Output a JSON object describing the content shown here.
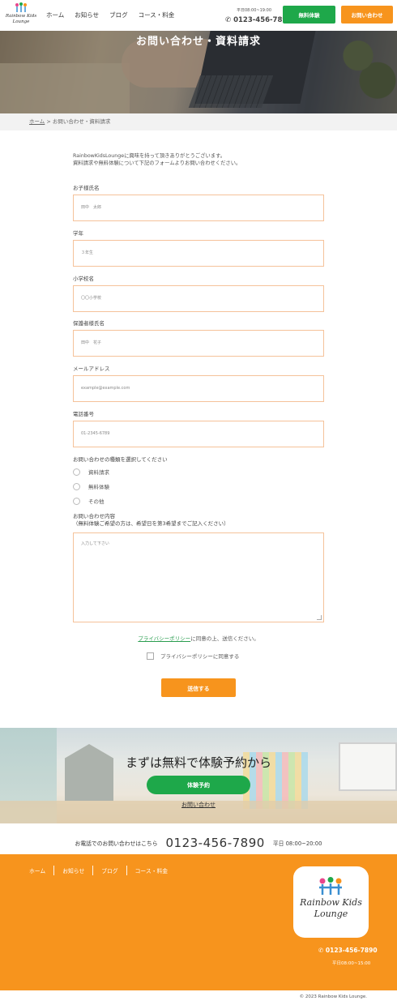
{
  "header": {
    "logo_text_line1": "Rainbow Kids",
    "logo_text_line2": "Lounge",
    "nav": [
      "ホーム",
      "お知らせ",
      "ブログ",
      "コース・料金"
    ],
    "hours": "平日08:00~19:00",
    "phone": "0123-456-7890",
    "trial_button": "無料体験",
    "contact_button": "お問い合わせ"
  },
  "hero": {
    "title": "お問い合わせ・資料請求"
  },
  "breadcrumb": {
    "home": "ホーム",
    "separator": ">",
    "current": "お問い合わせ・資料請求"
  },
  "form": {
    "intro_line1": "RainbowKidsLoungeに興味を持って頂きありがとうございます。",
    "intro_line2": "資料請求や無料体験について下記のフォームよりお問い合わせください。",
    "child_name_label": "お子様氏名",
    "child_name_placeholder": "田中　太郎",
    "grade_label": "学年",
    "grade_placeholder": "３年生",
    "school_label": "小学校名",
    "school_placeholder": "〇〇小学校",
    "guardian_label": "保護者様氏名",
    "guardian_placeholder": "田中　花子",
    "email_label": "メールアドレス",
    "email_placeholder": "example@example.com",
    "phone_label": "電話番号",
    "phone_placeholder": "01-2345-6789",
    "type_label": "お問い合わせの種類を選択してください",
    "type_options": [
      "資料請求",
      "無料体験",
      "その他"
    ],
    "message_label_line1": "お問い合わせ内容",
    "message_label_line2": "（無料体験ご希望の方は、希望日を第3希望までご記入ください）",
    "message_placeholder": "入力して下さい",
    "privacy_link": "プライバシーポリシー",
    "privacy_text": "に同意の上、送信ください。",
    "agree_label": "プライバシーポリシーに同意する",
    "submit": "送信する"
  },
  "cta": {
    "title": "まずは無料で体験予約から",
    "button": "体験予約",
    "link": "お問い合わせ"
  },
  "phone_strip": {
    "label": "お電話でのお問い合わせはこちら",
    "number": "0123-456-7890",
    "hours": "平日 08:00~20:00"
  },
  "footer": {
    "nav": [
      "ホーム",
      "お知らせ",
      "ブログ",
      "コース・料金"
    ],
    "logo_line1": "Rainbow Kids",
    "logo_line2": "Lounge",
    "phone": "0123-456-7890",
    "hours": "平日08:00~15:00",
    "copyright": "© 2023 Rainbow Kids Lounge."
  },
  "colors": {
    "accent_orange": "#f7941d",
    "accent_green": "#1ea84a",
    "field_border": "#f5c29a"
  },
  "icons": [
    "logo-icon",
    "phone-icon"
  ]
}
